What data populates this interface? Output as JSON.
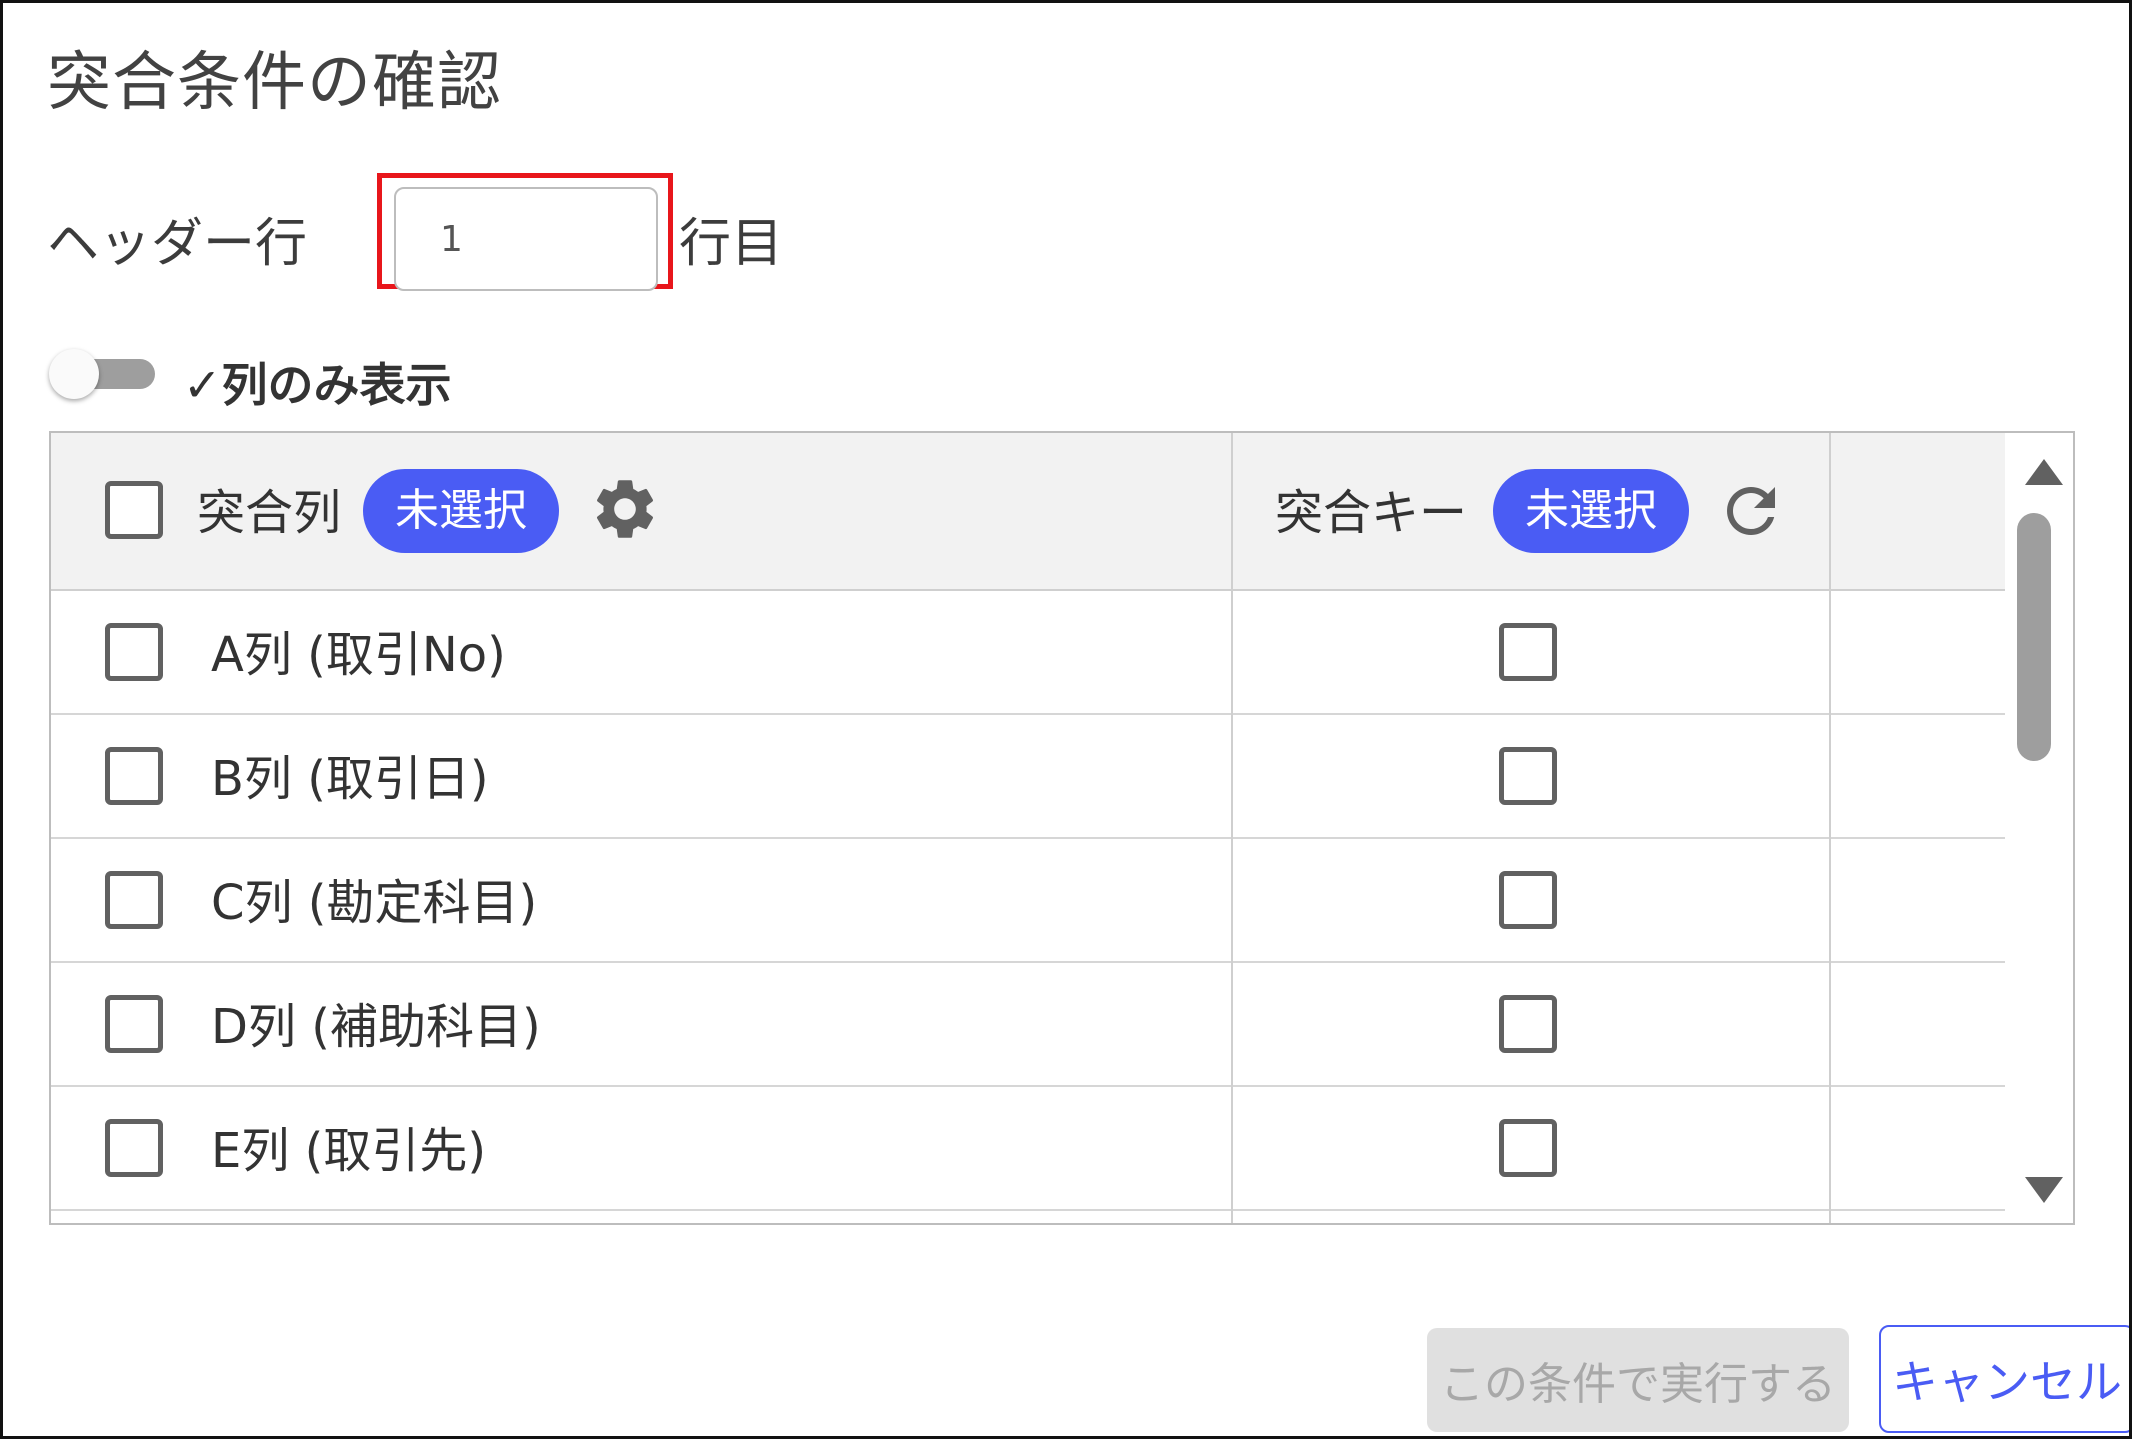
{
  "dialog": {
    "title": "突合条件の確認"
  },
  "header_row": {
    "label": "ヘッダー行",
    "value": "1",
    "suffix": "行目"
  },
  "toggle": {
    "label": "✓列のみ表示",
    "on": false
  },
  "table": {
    "columns": [
      {
        "label": "突合列",
        "badge": "未選択",
        "icon": "gear-icon"
      },
      {
        "label": "突合キー",
        "badge": "未選択",
        "icon": "refresh-icon"
      }
    ],
    "rows": [
      {
        "label": "A列 (取引No)"
      },
      {
        "label": "B列 (取引日)"
      },
      {
        "label": "C列 (勘定科目)"
      },
      {
        "label": "D列 (補助科目)"
      },
      {
        "label": "E列 (取引先)"
      }
    ]
  },
  "buttons": {
    "execute": "この条件で実行する",
    "cancel": "キャンセル"
  },
  "colors": {
    "accent": "#4a5cf4",
    "highlight": "#e8161b",
    "header_bg": "#f2f2f2"
  }
}
